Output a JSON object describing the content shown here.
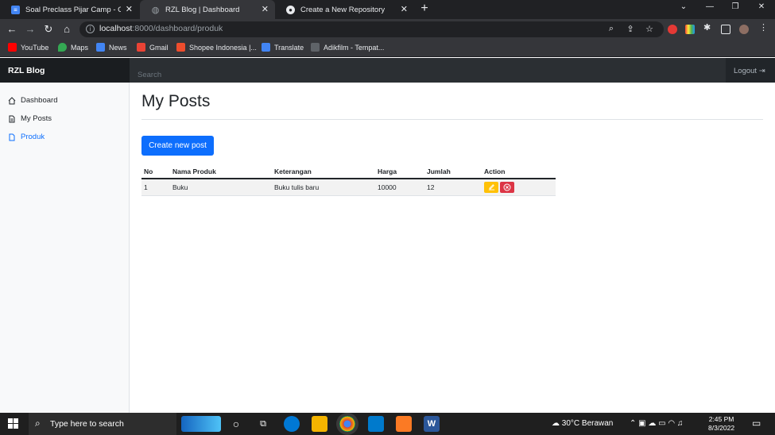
{
  "browser": {
    "tabs": [
      {
        "title": "Soal Preclass Pijar Camp - Google",
        "icon": "google-docs-icon",
        "active": false
      },
      {
        "title": "RZL Blog | Dashboard",
        "icon": "globe-icon",
        "active": true
      },
      {
        "title": "Create a New Repository",
        "icon": "github-icon",
        "active": false
      }
    ],
    "url_host": "localhost",
    "url_path": ":8000/dashboard/produk",
    "bookmarks": [
      "YouTube",
      "Maps",
      "News",
      "Gmail",
      "Shopee Indonesia |...",
      "Translate",
      "Adikfilm - Tempat..."
    ]
  },
  "navbar": {
    "brand": "RZL Blog",
    "search_placeholder": "Search",
    "logout_label": "Logout"
  },
  "sidebar": {
    "items": [
      {
        "label": "Dashboard",
        "icon": "home-icon"
      },
      {
        "label": "My Posts",
        "icon": "file-text-icon"
      },
      {
        "label": "Produk",
        "icon": "file-icon",
        "active": true
      }
    ]
  },
  "main": {
    "title": "My Posts",
    "create_button": "Create new post",
    "table": {
      "headers": [
        "No",
        "Nama Produk",
        "Keterangan",
        "Harga",
        "Jumlah",
        "Action"
      ],
      "rows": [
        {
          "no": "1",
          "nama": "Buku",
          "keterangan": "Buku tulis baru",
          "harga": "10000",
          "jumlah": "12"
        }
      ]
    }
  },
  "taskbar": {
    "search_placeholder": "Type here to search",
    "weather": "30°C  Berawan",
    "time": "2:45 PM",
    "date": "8/3/2022"
  },
  "colors": {
    "primary": "#0d6efd",
    "warning": "#ffc107",
    "danger": "#dc3545",
    "navbar": "#212529"
  }
}
